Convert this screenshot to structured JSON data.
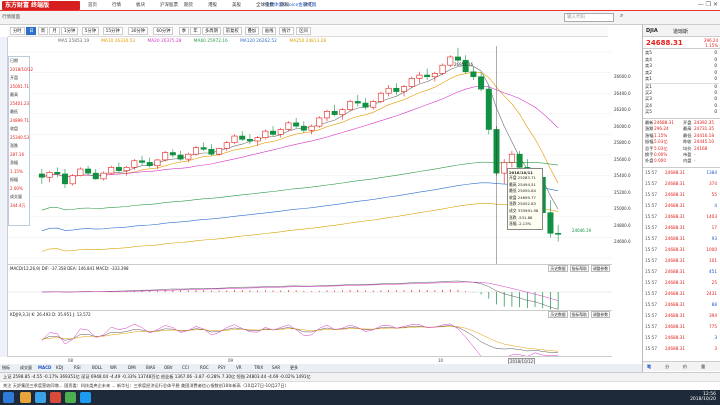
{
  "app": {
    "logo": "东方财富 终端版",
    "window_controls": "— ❐ ✕"
  },
  "top_menu": [
    "首页",
    "行情",
    "板块",
    "沪深股票",
    "期货",
    "港股",
    "美股",
    "全球指数",
    "期权",
    "外汇",
    "基金",
    "债券",
    "自选股",
    "条件",
    "F10资料",
    "资讯",
    "直播",
    "选股",
    "数据中心",
    "交易",
    "资金",
    "帮助"
  ],
  "top_notice": "免费体验Choice金融终端",
  "search": {
    "placeholder": "输入代码",
    "label": "道琼斯"
  },
  "toolbar_sector": "行情版面",
  "chart_toolbar": {
    "periods": [
      "分时",
      "日",
      "周",
      "月",
      "1分钟",
      "5分钟",
      "15分钟",
      "30分钟",
      "60分钟",
      "季",
      "年",
      "多周期"
    ],
    "active_period": "日",
    "buttons": [
      "前复权",
      "叠加",
      "画线",
      "统计",
      "区间"
    ]
  },
  "ma_line": [
    {
      "label": "MA5 25853.19",
      "color": "#6d6d6d"
    },
    {
      "label": "MA10 26330.53",
      "color": "#e59a00"
    },
    {
      "label": "MA20 26375.28",
      "color": "#d636c8"
    },
    {
      "label": "MA60 25972.16",
      "color": "#2d9b48"
    },
    {
      "label": "MA120 26262.52",
      "color": "#2e6fcf"
    },
    {
      "label": "MA250 24813.28",
      "color": "#d8a200"
    }
  ],
  "tooltip": {
    "date": "2018/10/11",
    "rows": [
      "开盘 25283.71",
      "最高 25494.51",
      "最低 25050.84",
      "收盘 24699.77",
      "涨跌 25052.83",
      "成交 333991.98",
      "涨跌 -531.88",
      "涨幅 -2.13%"
    ]
  },
  "left_panel": [
    "日期",
    "2018/10/12",
    "开盘",
    "25001.71",
    "最高",
    "25401.23",
    "最低",
    "24899.71",
    "收盘",
    "25340.53",
    "涨跌",
    "287.16",
    "涨幅",
    "1.15%",
    "振幅",
    "2.00%",
    "成交量",
    "344.4万"
  ],
  "annotations": {
    "high": "26951.16",
    "low": "24646.19"
  },
  "yaxis_main": [
    "26600.0",
    "26400.0",
    "26200.0",
    "26000.0",
    "25800.0",
    "25600.0",
    "25400.0",
    "25200.0",
    "25000.0",
    "24800.0",
    "24600.0"
  ],
  "macd_label": "MACD(12,26,9)  DIF: -37.358  DEA: 146.841  MACD: -333.398",
  "kdj_label": "KDJ(9,3,3)  K: 26.493  D: 35.951  J: 13.572",
  "panel_buttons": [
    "历史数据",
    "指标帮助",
    "调整参数"
  ],
  "xaxis": [
    "08",
    "09",
    "10",
    "2018/10/12"
  ],
  "bottom_tabs": [
    "指标",
    "成交量",
    "MACD",
    "KDJ",
    "RSI",
    "BOLL",
    "WR",
    "DMI",
    "BIAS",
    "OBV",
    "CCI",
    "ROC",
    "PSY",
    "VR",
    "TRIX",
    "SAR",
    "更多"
  ],
  "ticker": "上证 2598.85  -4.55  -0.17%  369351亿   深证 6948.04  -4.49  -0.33%  13748百亿   创业板 1367.06  -3.87  -0.28%   7.30亿   恒指 24803.44  -4.69  -0.02%  1491亿",
  "news": "关注  天舒集团三季度营收同增...  国资委：科技类央企未来 ... 新华社：三季度经济运行总体平稳  美国消费者信心指数创18年新高（10月27日-10月27日）",
  "right_panel": {
    "title": "道琼斯",
    "code": "DJIA",
    "price": "24688.31",
    "change": "296.24",
    "pct": "1.15%",
    "order_levels": [
      "卖5",
      "卖4",
      "卖3",
      "卖2",
      "卖1",
      "买1",
      "买2",
      "买3",
      "买4",
      "买5"
    ],
    "stats": [
      {
        "k": "最新",
        "v": "24688.31",
        "k2": "开盘",
        "v2": "24392.35"
      },
      {
        "k": "涨跌",
        "v": "296.24",
        "k2": "最高",
        "v2": "24731.35"
      },
      {
        "k": "涨幅",
        "v": "1.15%",
        "k2": "最低",
        "v2": "24416.18"
      },
      {
        "k": "振幅",
        "v": "5.03亿",
        "k2": "昨收",
        "v2": "24445.10"
      },
      {
        "k": "总手",
        "v": "5.03亿",
        "k2": "均价",
        "v2": "24168"
      },
      {
        "k": "换手",
        "v": "0.00%",
        "k2": "市盈",
        "v2": "-"
      },
      {
        "k": "外盘",
        "v": "0.000",
        "k2": "内盘",
        "v2": "-"
      }
    ],
    "ticks": [
      {
        "t": "15:57",
        "p": "24688.31",
        "v": "1384"
      },
      {
        "t": "15:57",
        "p": "24688.31",
        "v": "374"
      },
      {
        "t": "15:57",
        "p": "24688.31",
        "v": "55"
      },
      {
        "t": "15:57",
        "p": "24688.31",
        "v": "4"
      },
      {
        "t": "15:57",
        "p": "24688.31",
        "v": "1403"
      },
      {
        "t": "15:57",
        "p": "24688.31",
        "v": "17"
      },
      {
        "t": "15:57",
        "p": "24688.31",
        "v": "93"
      },
      {
        "t": "15:57",
        "p": "24688.31",
        "v": "1000"
      },
      {
        "t": "15:57",
        "p": "24688.31",
        "v": "101"
      },
      {
        "t": "15:57",
        "p": "24688.31",
        "v": "451"
      },
      {
        "t": "15:57",
        "p": "24688.31",
        "v": "25"
      },
      {
        "t": "15:57",
        "p": "24688.31",
        "v": "2431"
      },
      {
        "t": "15:57",
        "p": "24688.31",
        "v": "88"
      },
      {
        "t": "15:57",
        "p": "24688.31",
        "v": "394"
      },
      {
        "t": "15:57",
        "p": "24688.31",
        "v": "775"
      },
      {
        "t": "15:57",
        "p": "24688.31",
        "v": "3"
      },
      {
        "t": "15:57",
        "p": "24688.31",
        "v": "3"
      }
    ],
    "tabs": [
      "笔",
      "分",
      "价",
      "量"
    ]
  },
  "taskbar": {
    "time": "12:56",
    "date": "2018/10/20"
  },
  "chart_data": {
    "type": "candlestick",
    "ylim": [
      24400,
      26900
    ],
    "candles": [
      [
        25420,
        25480,
        25300,
        25380
      ],
      [
        25380,
        25460,
        25320,
        25440
      ],
      [
        25440,
        25500,
        25380,
        25420
      ],
      [
        25420,
        25480,
        25250,
        25300
      ],
      [
        25300,
        25420,
        25280,
        25400
      ],
      [
        25400,
        25500,
        25390,
        25480
      ],
      [
        25480,
        25520,
        25400,
        25430
      ],
      [
        25430,
        25480,
        25350,
        25360
      ],
      [
        25360,
        25450,
        25340,
        25430
      ],
      [
        25430,
        25520,
        25420,
        25500
      ],
      [
        25500,
        25560,
        25440,
        25460
      ],
      [
        25460,
        25520,
        25400,
        25500
      ],
      [
        25500,
        25600,
        25470,
        25580
      ],
      [
        25580,
        25640,
        25530,
        25560
      ],
      [
        25560,
        25620,
        25500,
        25520
      ],
      [
        25520,
        25600,
        25480,
        25590
      ],
      [
        25590,
        25700,
        25570,
        25680
      ],
      [
        25680,
        25720,
        25620,
        25650
      ],
      [
        25650,
        25700,
        25580,
        25600
      ],
      [
        25600,
        25680,
        25560,
        25660
      ],
      [
        25660,
        25760,
        25640,
        25740
      ],
      [
        25740,
        25800,
        25700,
        25720
      ],
      [
        25720,
        25780,
        25640,
        25660
      ],
      [
        25660,
        25740,
        25640,
        25730
      ],
      [
        25730,
        25820,
        25700,
        25800
      ],
      [
        25800,
        25900,
        25780,
        25880
      ],
      [
        25880,
        25940,
        25820,
        25840
      ],
      [
        25840,
        25900,
        25780,
        25820
      ],
      [
        25820,
        25880,
        25760,
        25860
      ],
      [
        25860,
        25960,
        25840,
        25940
      ],
      [
        25940,
        26000,
        25880,
        25900
      ],
      [
        25900,
        25980,
        25860,
        25960
      ],
      [
        25960,
        26060,
        25940,
        26040
      ],
      [
        26040,
        26100,
        25980,
        26000
      ],
      [
        26000,
        26060,
        25920,
        25950
      ],
      [
        25950,
        26020,
        25900,
        26000
      ],
      [
        26000,
        26120,
        25980,
        26100
      ],
      [
        26100,
        26200,
        26060,
        26180
      ],
      [
        26180,
        26260,
        26120,
        26140
      ],
      [
        26140,
        26220,
        26080,
        26200
      ],
      [
        26200,
        26320,
        26180,
        26300
      ],
      [
        26300,
        26380,
        26240,
        26280
      ],
      [
        26280,
        26340,
        26200,
        26230
      ],
      [
        26230,
        26320,
        26200,
        26300
      ],
      [
        26300,
        26420,
        26280,
        26400
      ],
      [
        26400,
        26500,
        26360,
        26460
      ],
      [
        26460,
        26520,
        26380,
        26420
      ],
      [
        26420,
        26500,
        26360,
        26480
      ],
      [
        26480,
        26600,
        26460,
        26580
      ],
      [
        26580,
        26660,
        26520,
        26620
      ],
      [
        26620,
        26700,
        26560,
        26600
      ],
      [
        26600,
        26660,
        26540,
        26640
      ],
      [
        26640,
        26760,
        26620,
        26740
      ],
      [
        26740,
        26860,
        26720,
        26840
      ],
      [
        26840,
        26951,
        26780,
        26800
      ],
      [
        26800,
        26860,
        26640,
        26660
      ],
      [
        26660,
        26720,
        26560,
        26600
      ],
      [
        26600,
        26650,
        26420,
        26450
      ],
      [
        26450,
        26500,
        25900,
        25960
      ],
      [
        25960,
        26000,
        25400,
        25430
      ],
      [
        25430,
        25600,
        25300,
        25560
      ],
      [
        25560,
        25700,
        25500,
        25660
      ],
      [
        25660,
        25700,
        25480,
        25500
      ],
      [
        25500,
        25600,
        25200,
        25250
      ],
      [
        25250,
        25400,
        25050,
        25380
      ],
      [
        25380,
        25400,
        24900,
        24950
      ],
      [
        24950,
        25100,
        24646,
        24700
      ],
      [
        24700,
        24800,
        24600,
        24688
      ]
    ]
  }
}
